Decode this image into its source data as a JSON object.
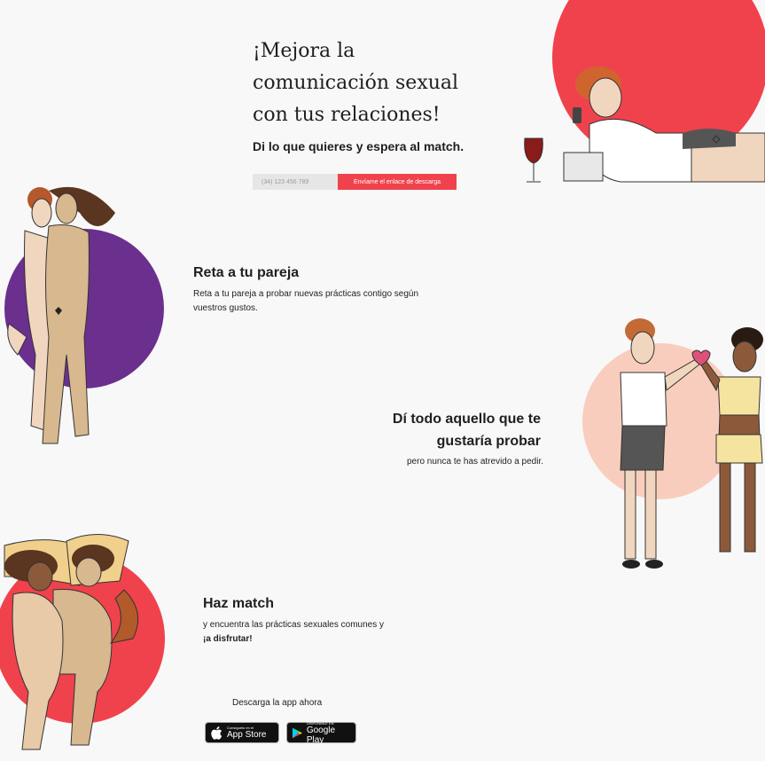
{
  "hero": {
    "title_lines": [
      "¡Mejora la",
      "comunicación sexual",
      "con tus relaciones!"
    ],
    "subtitle": "Di lo que quieres y espera al match."
  },
  "form": {
    "phone_placeholder": "(34) 123 456 789",
    "submit_label": "Envíame el enlace de descarga"
  },
  "sections": [
    {
      "title": "Reta a tu pareja",
      "text": "Reta a tu pareja a probar nuevas prácticas contigo según vuestros gustos."
    },
    {
      "title_lines": [
        "Dí todo aquello que te",
        "gustaría probar"
      ],
      "text": "pero nunca te has atrevido a pedir."
    },
    {
      "title": "Haz match",
      "text": "y encuentra las prácticas sexuales comunes y",
      "text_bold": "¡a disfrutar!"
    }
  ],
  "download": {
    "label": "Descarga la app ahora",
    "appstore_small": "Consíguelo en el",
    "appstore_big": "App Store",
    "gplay_small": "DISPONIBLE EN",
    "gplay_big": "Google Play"
  },
  "colors": {
    "red": "#f0424c",
    "purple": "#6b2f8e",
    "peach": "#f9cdbd",
    "background": "#f8f8f8"
  }
}
